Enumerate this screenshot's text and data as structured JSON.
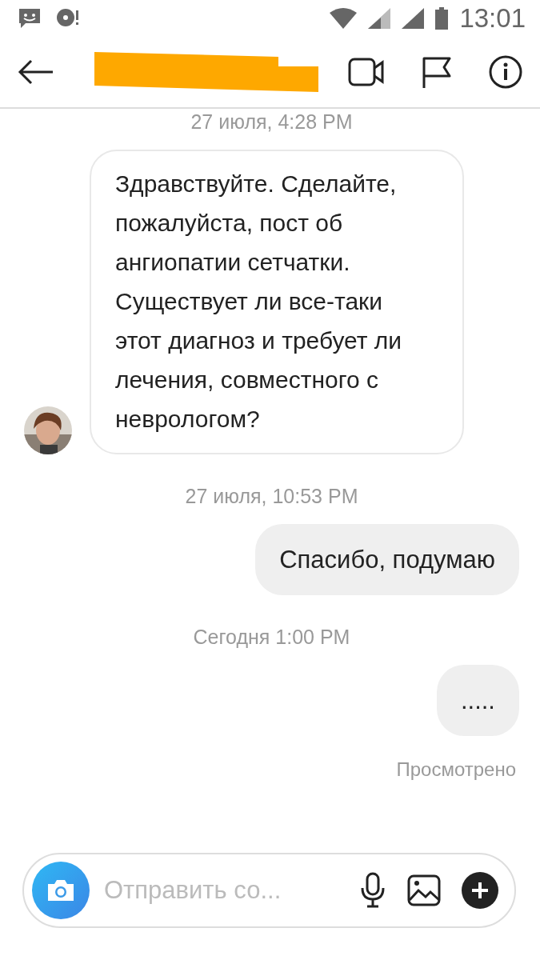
{
  "status_bar": {
    "time": "13:01"
  },
  "messages": [
    {
      "kind": "timestamp",
      "text": "27 июля, 4:28 PM"
    },
    {
      "kind": "incoming",
      "text": "Здравствуйте. Сделайте, пожалуйста, пост об ангиопатии сетчатки. Существует ли все-таки этот диагноз и требует ли лечения, совместного с неврологом?"
    },
    {
      "kind": "timestamp",
      "text": "27 июля, 10:53 PM"
    },
    {
      "kind": "outgoing",
      "text": "Спасибо, подумаю"
    },
    {
      "kind": "timestamp",
      "text": "Сегодня 1:00 PM"
    },
    {
      "kind": "outgoing",
      "text": "....."
    },
    {
      "kind": "seen",
      "text": "Просмотрено"
    }
  ],
  "composer": {
    "placeholder": "Отправить со..."
  }
}
